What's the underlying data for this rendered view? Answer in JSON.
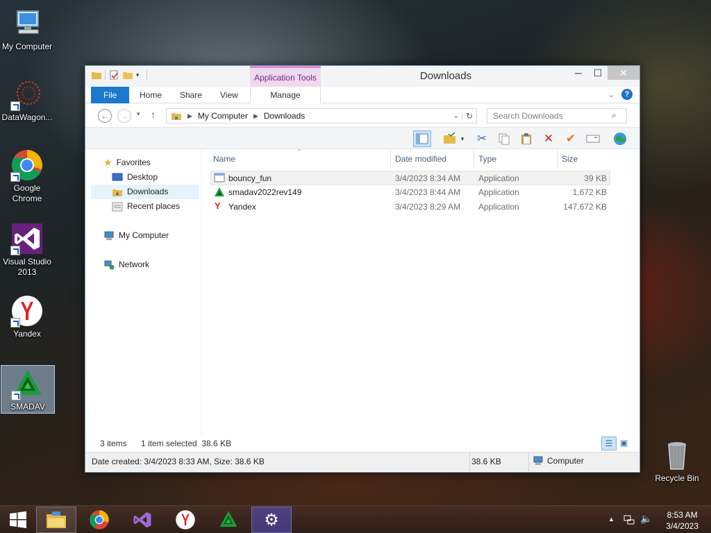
{
  "desktop": {
    "icons": [
      {
        "label": "My Computer"
      },
      {
        "label": "DataWagon..."
      },
      {
        "label": "Google Chrome"
      },
      {
        "label": "Visual Studio 2013"
      },
      {
        "label": "Yandex"
      },
      {
        "label": "SMADAV"
      },
      {
        "label": "Recycle Bin"
      }
    ]
  },
  "window": {
    "title": "Downloads",
    "context_tab": "Application Tools",
    "ribbon_tabs": [
      "File",
      "Home",
      "Share",
      "View",
      "Manage"
    ],
    "address": {
      "crumbs": [
        "My Computer",
        "Downloads"
      ]
    },
    "search": {
      "placeholder": "Search Downloads"
    },
    "nav": {
      "favorites": "Favorites",
      "items": [
        "Desktop",
        "Downloads",
        "Recent places"
      ],
      "computer": "My Computer",
      "network": "Network"
    },
    "columns": [
      "Name",
      "Date modified",
      "Type",
      "Size"
    ],
    "files": [
      {
        "name": "bouncy_fun",
        "date": "3/4/2023 8:34 AM",
        "type": "Application",
        "size": "39 KB"
      },
      {
        "name": "smadav2022rev149",
        "date": "3/4/2023 8:44 AM",
        "type": "Application",
        "size": "1,672 KB"
      },
      {
        "name": "Yandex",
        "date": "3/4/2023 8:29 AM",
        "type": "Application",
        "size": "147,672 KB"
      }
    ],
    "status": {
      "count": "3 items",
      "selection": "1 item selected  38.6 KB"
    },
    "details": {
      "info": "Date created: 3/4/2023 8:33 AM, Size: 38.6 KB",
      "size": "38.6 KB",
      "location": "Computer"
    }
  },
  "taskbar": {
    "clock_time": "8:53 AM",
    "clock_date": "3/4/2023"
  },
  "colors": {
    "accent": "#1979ca",
    "context_tab": "#f0d8ef"
  }
}
